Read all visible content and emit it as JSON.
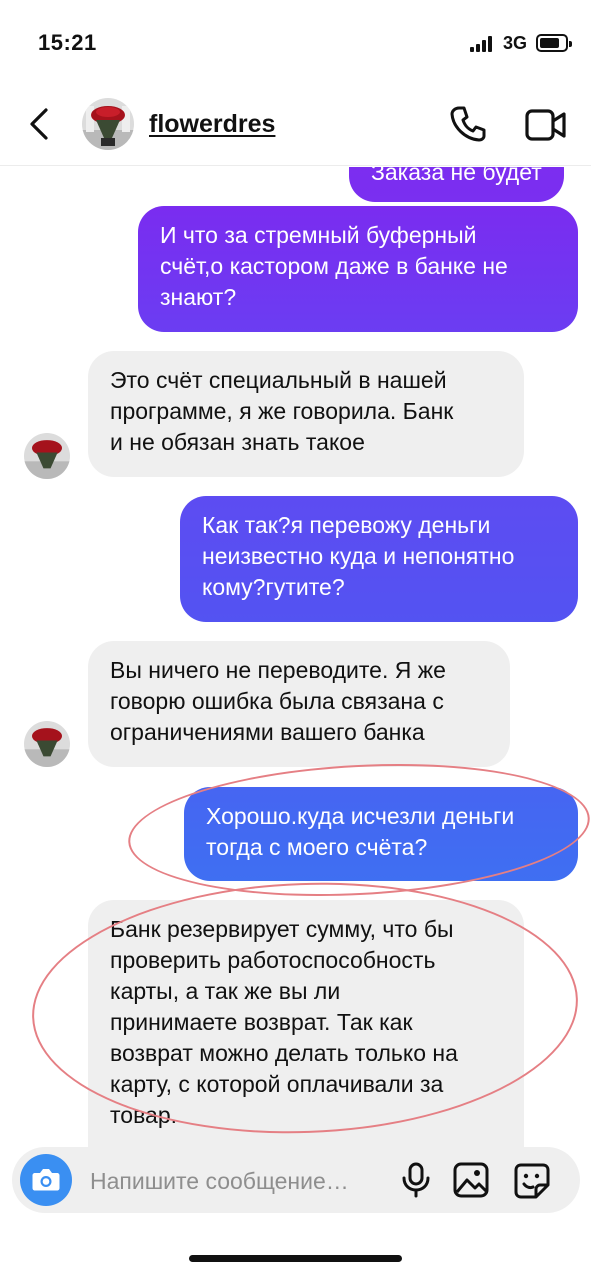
{
  "status_bar": {
    "time": "15:21",
    "network": "3G",
    "battery_level": 0.8
  },
  "header": {
    "username": "flowerdres",
    "icons": [
      "back-icon",
      "phone-icon",
      "video-icon"
    ]
  },
  "colors": {
    "outgoing_top": "#7a2cf0",
    "outgoing_bottom": "#3f6ff2",
    "incoming": "#efefef",
    "annotation": "#e57f84",
    "camera": "#3a8ff2"
  },
  "messages": [
    {
      "from": "me",
      "lines": [
        "Заказа не будет"
      ]
    },
    {
      "from": "me",
      "lines": [
        "И что за стремный буферный",
        "счёт,о кастором даже в банке не",
        "знают?"
      ]
    },
    {
      "from": "them",
      "lines": [
        "Это счёт специальный в нашей",
        "программе, я же говорила. Банк",
        "и не обязан знать такое"
      ]
    },
    {
      "from": "me",
      "lines": [
        "Как так?я перевожу деньги",
        "неизвестно куда и непонятно",
        "кому?гутите?"
      ]
    },
    {
      "from": "them",
      "lines": [
        "Вы ничего не переводите. Я же",
        "говорю ошибка была связана с",
        "ограничениями вашего банка"
      ]
    },
    {
      "from": "me",
      "lines": [
        "Хорошо.куда исчезли деньги",
        "тогда с моего счёта?"
      ]
    },
    {
      "from": "them",
      "lines": [
        "Банк резервирует сумму, что бы",
        "проверить работоспособность",
        "карты, а так же вы ли",
        "принимаете возврат. Так как",
        "возврат можно делать только на",
        "карту, с которой оплачивали за",
        "товар."
      ]
    }
  ],
  "composer": {
    "placeholder": "Напишите сообщение…",
    "icons": [
      "camera-icon",
      "microphone-icon",
      "gallery-icon",
      "sticker-icon"
    ]
  }
}
